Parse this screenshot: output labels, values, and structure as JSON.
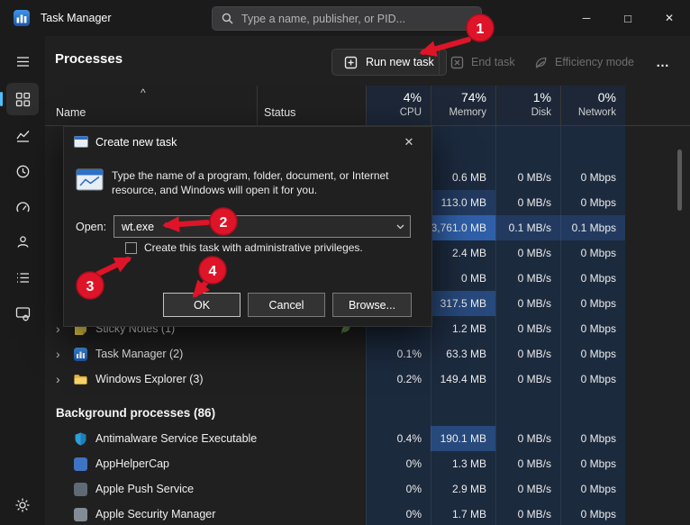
{
  "window": {
    "title": "Task Manager",
    "search_placeholder": "Type a name, publisher, or PID...",
    "minimize": "─",
    "maximize": "□",
    "close": "✕"
  },
  "sidebar": {
    "icons": [
      "menu",
      "processes",
      "performance",
      "app-history",
      "startup-apps",
      "users",
      "details",
      "services",
      "settings"
    ]
  },
  "toolbar": {
    "page_title": "Processes",
    "run_new_task": "Run new task",
    "end_task": "End task",
    "efficiency_mode": "Efficiency mode",
    "more": "…"
  },
  "table": {
    "sort_caret": "^",
    "name_header": "Name",
    "status_header": "Status",
    "usage_headers": [
      {
        "pct": "4%",
        "label": "CPU"
      },
      {
        "pct": "74%",
        "label": "Memory"
      },
      {
        "pct": "1%",
        "label": "Disk"
      },
      {
        "pct": "0%",
        "label": "Network"
      }
    ]
  },
  "processes": {
    "rows": [
      {
        "name": "",
        "cpu": "",
        "memory": "0.6 MB",
        "disk": "0 MB/s",
        "network": "0 Mbps"
      },
      {
        "name": "",
        "cpu": "",
        "memory": "113.0 MB",
        "disk": "0 MB/s",
        "network": "0 Mbps",
        "memory_hl": "low"
      },
      {
        "name": "",
        "cpu": "",
        "memory": "3,761.0 MB",
        "disk": "0.1 MB/s",
        "network": "0.1 Mbps",
        "memory_hl": "hi",
        "disk_hl": "low",
        "network_hl": "low"
      },
      {
        "name": "",
        "cpu": "",
        "memory": "2.4 MB",
        "disk": "0 MB/s",
        "network": "0 Mbps"
      },
      {
        "name": "",
        "cpu": "",
        "memory": "0 MB",
        "disk": "0 MB/s",
        "network": "0 Mbps"
      },
      {
        "name": "",
        "cpu": "",
        "memory": "317.5 MB",
        "disk": "0 MB/s",
        "network": "0 Mbps",
        "memory_hl": "mid"
      },
      {
        "name": "Sticky Notes (1)",
        "chevron": "›",
        "cpu": "",
        "memory": "1.2 MB",
        "disk": "0 MB/s",
        "network": "0 Mbps"
      },
      {
        "name": "Task Manager (2)",
        "chevron": "›",
        "cpu": "0.1%",
        "memory": "63.3 MB",
        "disk": "0 MB/s",
        "network": "0 Mbps"
      },
      {
        "name": "Windows Explorer (3)",
        "chevron": "›",
        "cpu": "0.2%",
        "memory": "149.4 MB",
        "disk": "0 MB/s",
        "network": "0 Mbps"
      }
    ],
    "background_header": "Background processes (86)",
    "background_rows": [
      {
        "name": "Antimalware Service Executable",
        "cpu": "0.4%",
        "memory": "190.1 MB",
        "disk": "0 MB/s",
        "network": "0 Mbps",
        "memory_hl": "mid"
      },
      {
        "name": "AppHelperCap",
        "cpu": "0%",
        "memory": "1.3 MB",
        "disk": "0 MB/s",
        "network": "0 Mbps"
      },
      {
        "name": "Apple Push Service",
        "cpu": "0%",
        "memory": "2.9 MB",
        "disk": "0 MB/s",
        "network": "0 Mbps"
      },
      {
        "name": "Apple Security Manager",
        "cpu": "0%",
        "memory": "1.7 MB",
        "disk": "0 MB/s",
        "network": "0 Mbps"
      }
    ]
  },
  "dialog": {
    "title": "Create new task",
    "close": "✕",
    "message": "Type the name of a program, folder, document, or Internet resource, and Windows will open it for you.",
    "open_label": "Open:",
    "open_value": "wt.exe",
    "checkbox_label": "Create this task with administrative privileges.",
    "ok": "OK",
    "cancel": "Cancel",
    "browse": "Browse..."
  },
  "annotations": {
    "step1": "1",
    "step2": "2",
    "step3": "3",
    "step4": "4"
  },
  "colors": {
    "titlebar_bg": "#1b1b1b",
    "content_bg": "#202020",
    "heat_base": "#1c2a3e",
    "heat_low": "#223a5f",
    "heat_mid": "#27497c",
    "heat_hi": "#2f5fa8",
    "annotation_red": "#de1428",
    "accent_blue": "#4cc2ff"
  }
}
